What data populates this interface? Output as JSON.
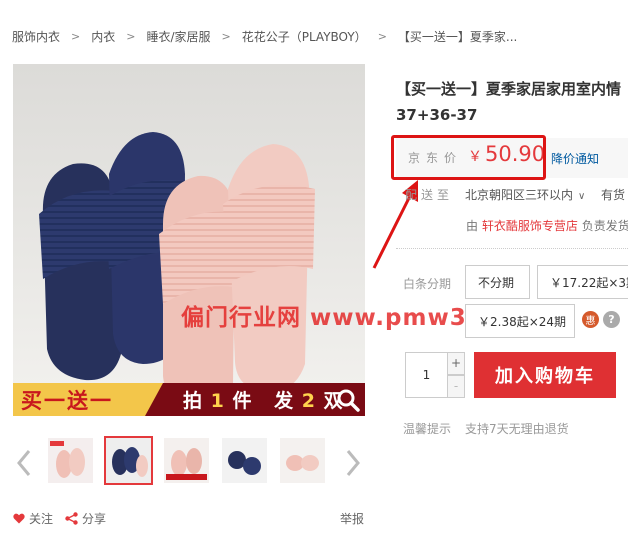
{
  "breadcrumb": [
    "服饰内衣",
    "内衣",
    "睡衣/家居服",
    "花花公子（PLAYBOY）",
    "【买一送一】夏季家..."
  ],
  "breadcrumb_sep": ">",
  "promo": {
    "left": "买一送一",
    "buy": "拍",
    "buy_n": "1",
    "buy_unit": "件",
    "get": "发",
    "get_n": "2",
    "get_unit": "双"
  },
  "product": {
    "title": "【买一送一】夏季家居家用室内情",
    "subtitle": "37+36-37"
  },
  "price": {
    "label": "京东价",
    "currency": "￥",
    "value": "50.90",
    "alert": "降价通知"
  },
  "delivery": {
    "label": "配送至",
    "address": "北京朝阳区三环以内",
    "stock": "有货"
  },
  "seller": {
    "prefix": "由",
    "shop": "轩衣酷服饰专营店",
    "suffix": "负责发货"
  },
  "installment": {
    "label": "白条分期",
    "options": [
      "不分期",
      "￥17.22起×3期",
      "￥2.38起×24期"
    ],
    "badge": "惠",
    "help": "?"
  },
  "quantity": {
    "value": "1",
    "plus": "+",
    "minus": "-"
  },
  "cart_button": "加入购物车",
  "tips": {
    "label": "温馨提示",
    "text": "支持7天无理由退货"
  },
  "actions": {
    "follow": "关注",
    "share": "分享",
    "report": "举报"
  },
  "watermark": "偏门行业网 www.pmw365.com",
  "colors": {
    "accent": "#e4393c",
    "cart": "#df3033",
    "link": "#005aa0",
    "highlight": "#dd1414"
  }
}
